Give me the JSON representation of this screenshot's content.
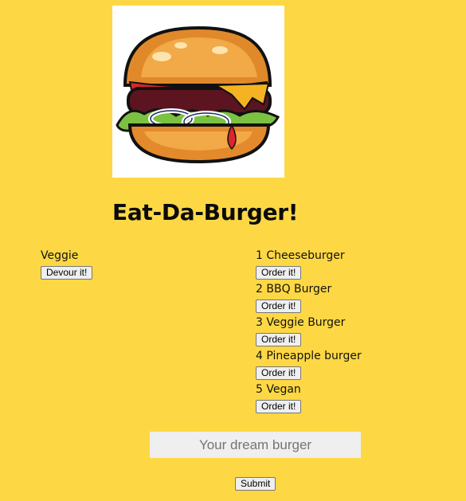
{
  "title": "Eat-Da-Burger!",
  "logo": {
    "icon": "burger-icon"
  },
  "devoured": [
    {
      "name": "Veggie",
      "button": "Devour it!"
    }
  ],
  "menu": [
    {
      "name": "1 Cheeseburger",
      "button": "Order it!"
    },
    {
      "name": "2 BBQ Burger",
      "button": "Order it!"
    },
    {
      "name": "3 Veggie Burger",
      "button": "Order it!"
    },
    {
      "name": "4 Pineapple burger",
      "button": "Order it!"
    },
    {
      "name": "5 Vegan",
      "button": "Order it!"
    }
  ],
  "form": {
    "placeholder": "Your dream burger",
    "value": "",
    "submit_label": "Submit"
  },
  "colors": {
    "background": "#fed844",
    "input_background": "#efefef"
  }
}
